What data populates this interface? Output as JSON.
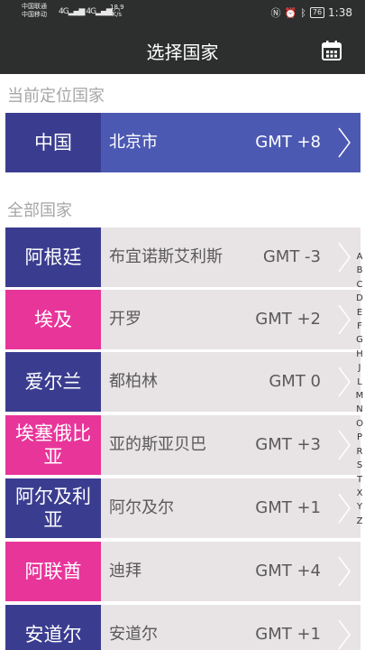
{
  "status_bar": {
    "carrier1": "中国联通",
    "carrier2": "中国移动",
    "net1": "4G",
    "net2": "4G",
    "speed_value": "18.9",
    "speed_unit": "K/s",
    "battery": "76",
    "time": "1:38"
  },
  "header": {
    "title": "选择国家",
    "calendar_icon": "calendar-icon"
  },
  "current_section": {
    "title": "当前定位国家",
    "item": {
      "country": "中国",
      "city": "北京市",
      "gmt": "GMT +8"
    }
  },
  "all_section": {
    "title": "全部国家",
    "items": [
      {
        "country": "阿根廷",
        "city": "布宜诺斯艾利斯",
        "gmt": "GMT -3"
      },
      {
        "country": "埃及",
        "city": "开罗",
        "gmt": "GMT +2"
      },
      {
        "country": "爱尔兰",
        "city": "都柏林",
        "gmt": "GMT 0"
      },
      {
        "country": "埃塞俄比亚",
        "city": "亚的斯亚贝巴",
        "gmt": "GMT +3"
      },
      {
        "country": "阿尔及利亚",
        "city": "阿尔及尔",
        "gmt": "GMT +1"
      },
      {
        "country": "阿联酋",
        "city": "迪拜",
        "gmt": "GMT +4"
      },
      {
        "country": "安道尔",
        "city": "安道尔",
        "gmt": "GMT +1"
      }
    ]
  },
  "index_letters": [
    "A",
    "B",
    "C",
    "D",
    "E",
    "F",
    "G",
    "H",
    "J",
    "L",
    "M",
    "N",
    "O",
    "P",
    "R",
    "S",
    "T",
    "X",
    "Y",
    "Z"
  ],
  "colors": {
    "header_bg": "#2d2e2e",
    "navy": "#3a3d8f",
    "pink": "#e8359a",
    "current_blue": "#4c59b3",
    "row_gray": "#e8e3e5"
  }
}
